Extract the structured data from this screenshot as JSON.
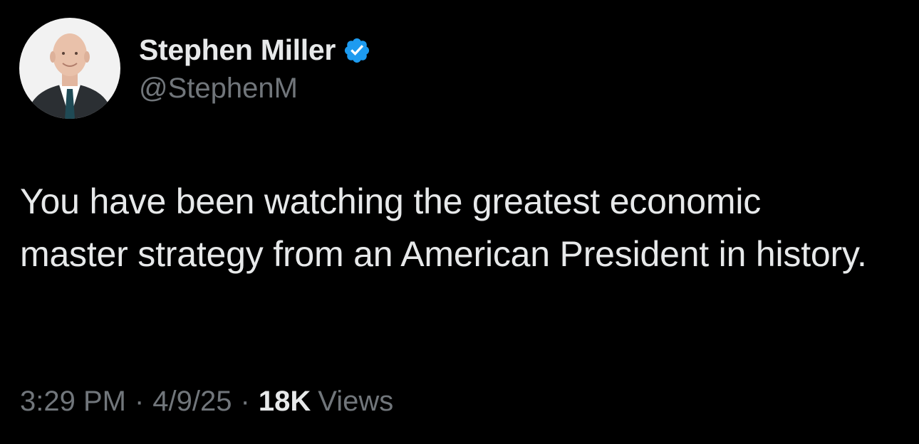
{
  "author": {
    "display_name": "Stephen Miller",
    "handle": "@StephenM",
    "verified": true,
    "verified_icon": "verified-badge-icon",
    "avatar_icon": "profile-photo"
  },
  "tweet": {
    "text": "You have been watching the greatest economic master strategy from an American President in history."
  },
  "meta": {
    "time": "3:29 PM",
    "separator": "·",
    "date": "4/9/25",
    "views_count": "18K",
    "views_label": "Views"
  },
  "colors": {
    "background": "#000000",
    "primary_text": "#e7e9ea",
    "secondary_text": "#71767b",
    "verified_blue": "#1d9bf0"
  }
}
